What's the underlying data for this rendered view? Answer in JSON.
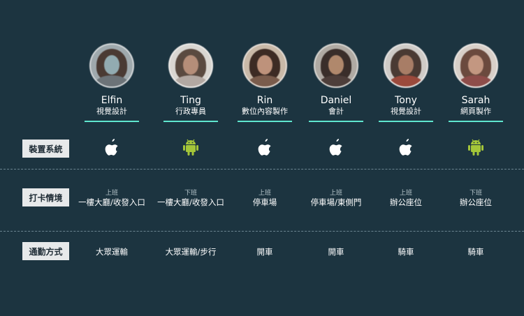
{
  "people": [
    {
      "name": "Elfin",
      "role": "視覺設計",
      "device": "apple-icon",
      "checkin_shift": "上班",
      "checkin_location": "一樓大廳/收發入口",
      "commute": "大眾運輸"
    },
    {
      "name": "Ting",
      "role": "行政專員",
      "device": "android-icon",
      "checkin_shift": "下班",
      "checkin_location": "一樓大廳/收發入口",
      "commute": "大眾運輸/步行"
    },
    {
      "name": "Rin",
      "role": "數位內容製作",
      "device": "apple-icon",
      "checkin_shift": "上班",
      "checkin_location": "停車場",
      "commute": "開車"
    },
    {
      "name": "Daniel",
      "role": "會計",
      "device": "apple-icon",
      "checkin_shift": "上班",
      "checkin_location": "停車場/東側門",
      "commute": "開車"
    },
    {
      "name": "Tony",
      "role": "視覺設計",
      "device": "apple-icon",
      "checkin_shift": "上班",
      "checkin_location": "辦公座位",
      "commute": "騎車"
    },
    {
      "name": "Sarah",
      "role": "網頁製作",
      "device": "android-icon",
      "checkin_shift": "下班",
      "checkin_location": "辦公座位",
      "commute": "騎車"
    }
  ],
  "rows": {
    "device_label": "裝置系統",
    "checkin_label": "打卡情境",
    "commute_label": "通勤方式"
  },
  "colors": {
    "background": "#1c3440",
    "accent": "#5fe6cf",
    "android": "#a4c639",
    "label_bg": "#e7e9ea"
  }
}
